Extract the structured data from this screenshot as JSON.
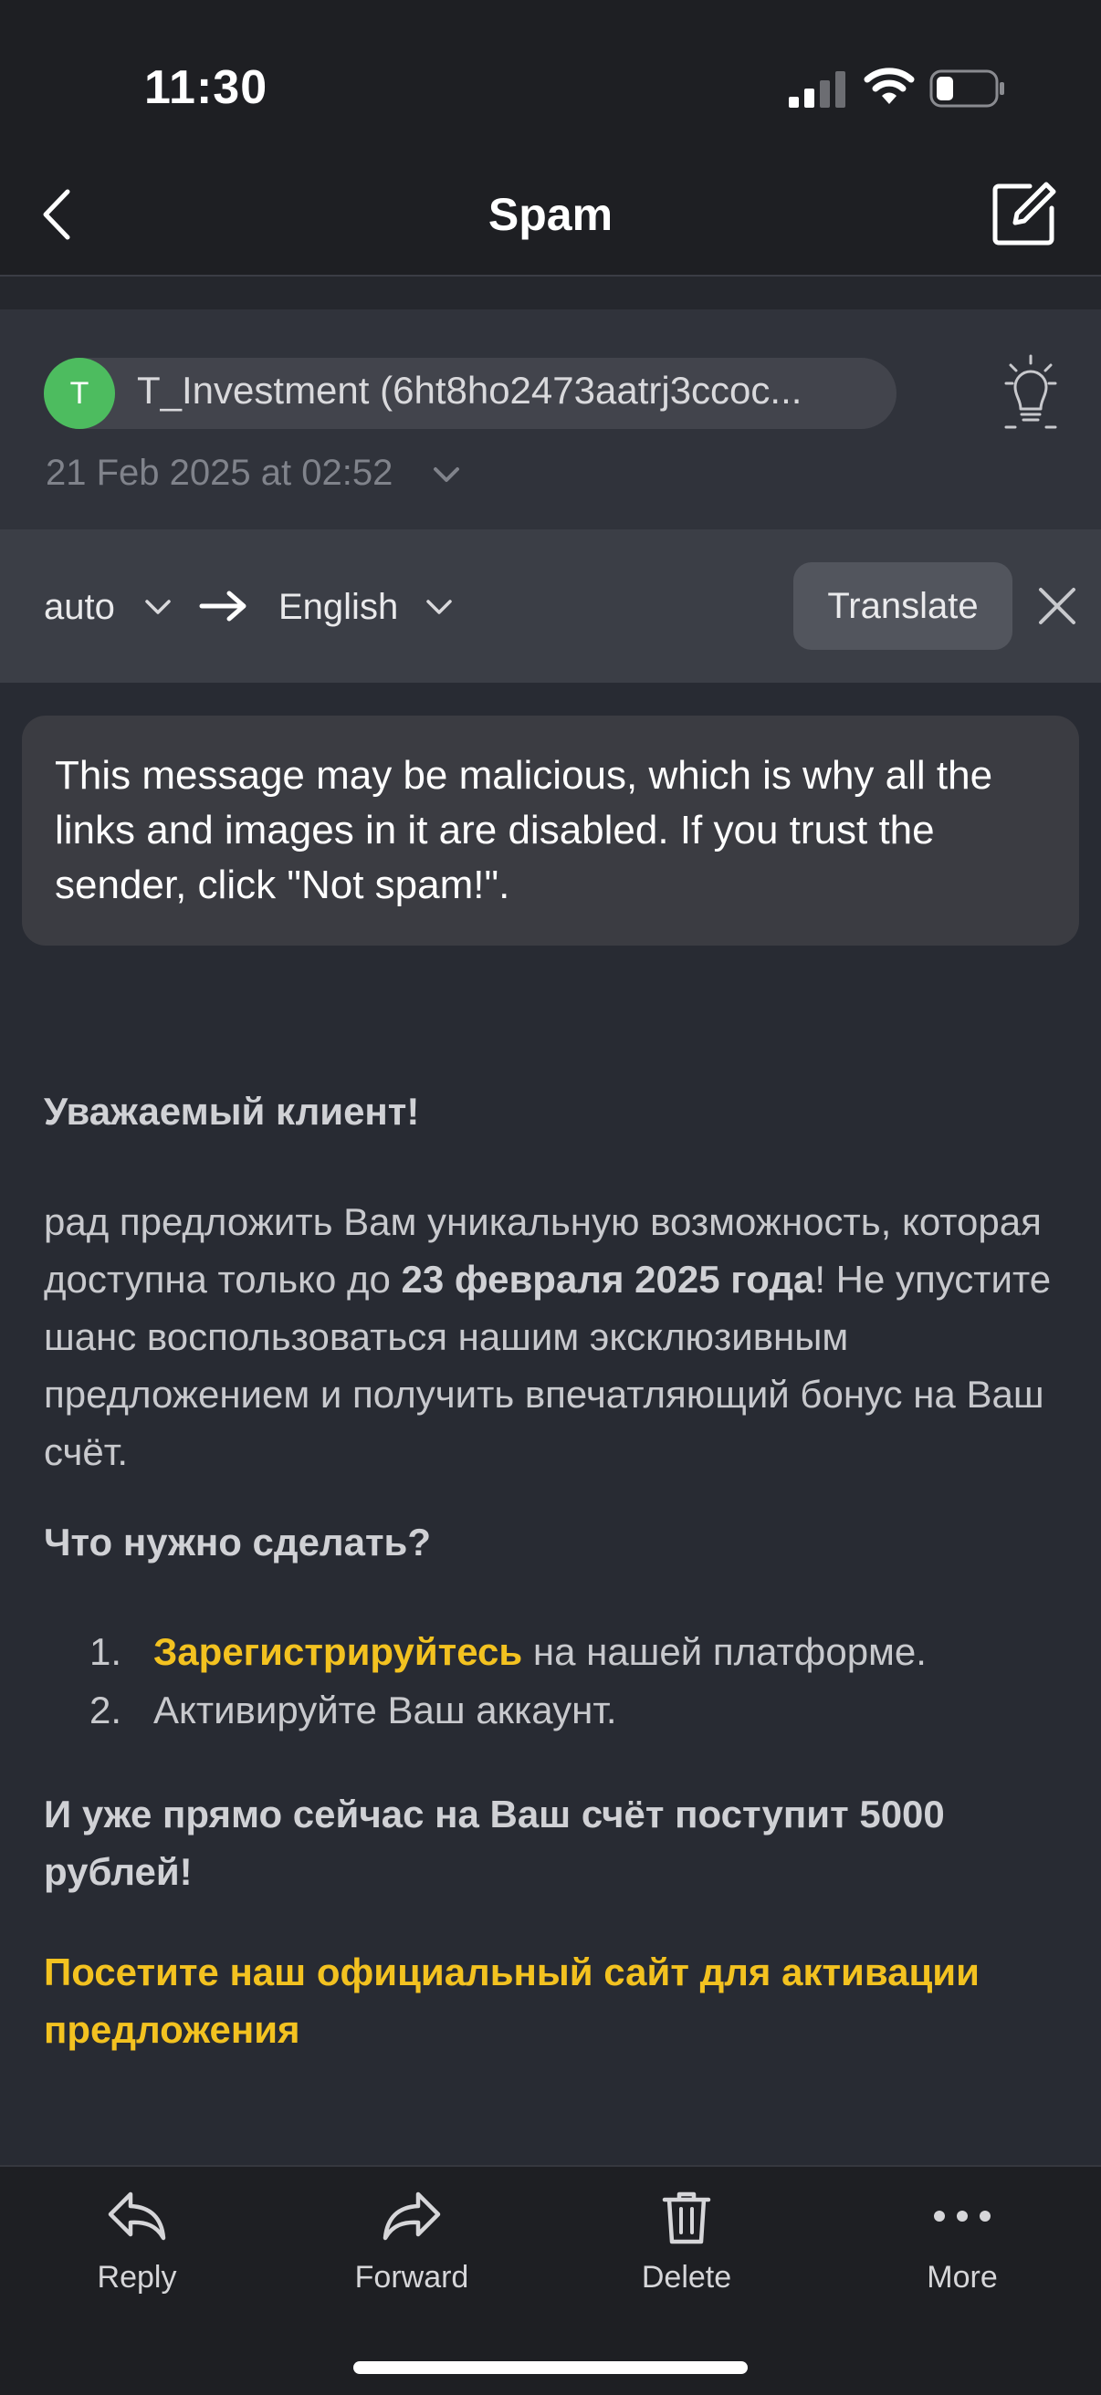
{
  "status_bar": {
    "time": "11:30"
  },
  "nav": {
    "title": "Spam"
  },
  "message": {
    "sender_initial": "T",
    "sender": "T_Investment (6ht8ho2473aatrj3ccoc...",
    "date": "21 Feb 2025 at 02:52"
  },
  "translate": {
    "source_lang": "auto",
    "target_lang": "English",
    "button": "Translate"
  },
  "warning": "This message may be malicious, which is why all the links and images in it are disabled. If you trust the sender, click \"Not spam!\".",
  "body": {
    "greeting": "Уважаемый клиент!",
    "para_part1": "рад предложить Вам уникальную возможность, которая доступна только до ",
    "para_bold": "23 февраля 2025 года",
    "para_part2": "! Не упустите шанс воспользоваться нашим эксклюзивным предложением и получить впечатляющий бонус на Ваш счёт.",
    "question": "Что нужно сделать?",
    "step1_num": "1.",
    "step1_link": "Зарегистрируйтесь",
    "step1_rest": " на нашей платформе.",
    "step2_num": "2.",
    "step2": "Активируйте Ваш аккаунт.",
    "promise": "И уже прямо сейчас на Ваш счёт поступит 5000 рублей!",
    "visit": "Посетите наш официальный сайт для активации предложения"
  },
  "toolbar": {
    "reply": "Reply",
    "forward": "Forward",
    "delete": "Delete",
    "more": "More"
  },
  "colors": {
    "accent_yellow": "#f3c220",
    "avatar_green": "#4dbc5f"
  }
}
